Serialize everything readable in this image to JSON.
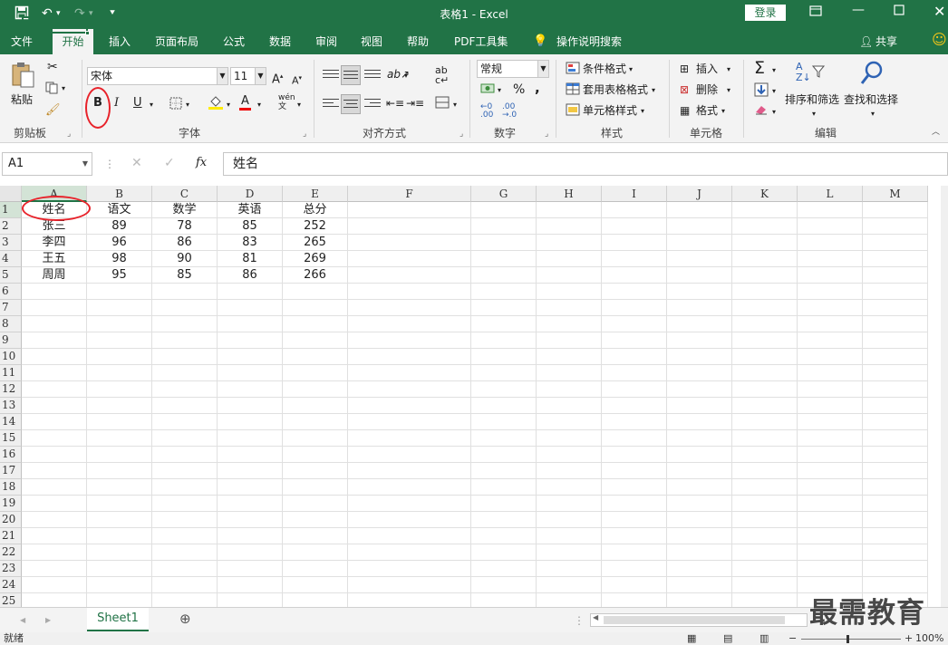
{
  "window": {
    "title": "表格1  -  Excel",
    "login": "登录"
  },
  "menu": {
    "file": "文件",
    "home": "开始",
    "insert": "插入",
    "layout": "页面布局",
    "formulas": "公式",
    "data": "数据",
    "review": "审阅",
    "view": "视图",
    "help": "帮助",
    "pdf": "PDF工具集",
    "search": "操作说明搜索",
    "share": "共享"
  },
  "ribbon": {
    "clipboard": {
      "paste": "粘贴",
      "label": "剪贴板"
    },
    "font": {
      "name": "宋体",
      "size": "11",
      "bold": "B",
      "italic": "I",
      "underline": "U",
      "label": "字体",
      "wen": "wén"
    },
    "align": {
      "label": "对齐方式"
    },
    "number": {
      "format": "常规",
      "percent": "%",
      "comma": ",",
      "label": "数字"
    },
    "styles": {
      "cond": "条件格式",
      "table": "套用表格格式",
      "cell": "单元格样式",
      "label": "样式"
    },
    "cells": {
      "insert": "插入",
      "delete": "删除",
      "format": "格式",
      "label": "单元格"
    },
    "edit": {
      "sort": "排序和筛选",
      "find": "查找和选择",
      "label": "编辑"
    }
  },
  "formula": {
    "namebox": "A1",
    "fx": "fx",
    "content": "姓名"
  },
  "columns": [
    "A",
    "B",
    "C",
    "D",
    "E",
    "F",
    "G",
    "H",
    "I",
    "J",
    "K",
    "L",
    "M"
  ],
  "rows_count": 25,
  "table": [
    [
      "姓名",
      "语文",
      "数学",
      "英语",
      "总分"
    ],
    [
      "张三",
      "89",
      "78",
      "85",
      "252"
    ],
    [
      "李四",
      "96",
      "86",
      "83",
      "265"
    ],
    [
      "王五",
      "98",
      "90",
      "81",
      "269"
    ],
    [
      "周周",
      "95",
      "85",
      "86",
      "266"
    ]
  ],
  "sheets": {
    "active": "Sheet1"
  },
  "status": {
    "ready": "就绪",
    "zoom": "100%"
  },
  "watermark": "最需教育",
  "colors": {
    "accent": "#217346",
    "annotation": "#e8222a"
  }
}
